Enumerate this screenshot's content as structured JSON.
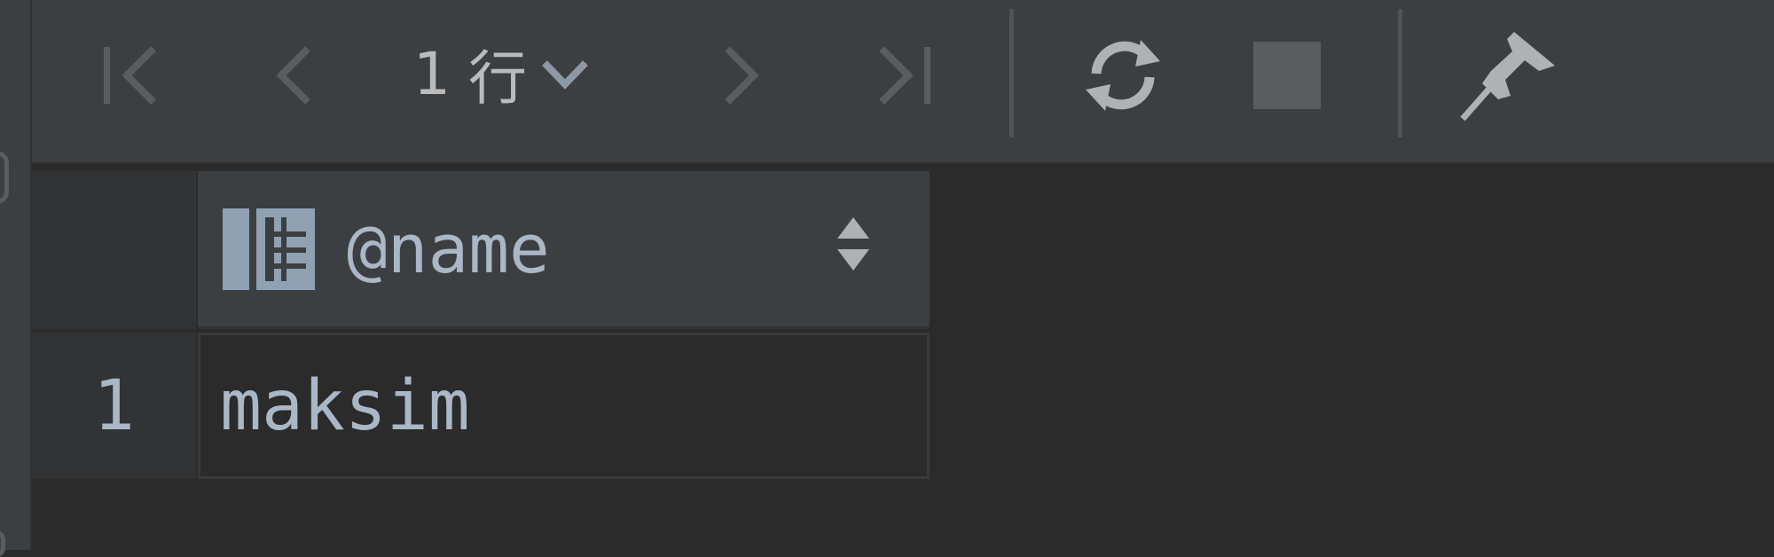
{
  "toolbar": {
    "first_icon": "first-page-icon",
    "prev_icon": "previous-page-icon",
    "row_count_number": "1",
    "row_count_unit": "行",
    "row_count_dropdown_icon": "chevron-down-icon",
    "next_icon": "next-page-icon",
    "last_icon": "last-page-icon",
    "refresh_icon": "refresh-icon",
    "stop_icon": "stop-icon",
    "pin_icon": "pin-icon"
  },
  "table": {
    "column_icon": "column-table-icon",
    "sort_icon": "sort-updown-icon",
    "columns": [
      "@name"
    ],
    "rows": [
      {
        "num": "1",
        "cells": [
          "maksim"
        ]
      }
    ]
  },
  "colors": {
    "toolbar_bg": "#3c3f41",
    "grid_bg": "#2b2b2b",
    "text": "#a9b7c6",
    "icon_disabled": "#5a5d5f",
    "icon_enabled": "#afb1b3"
  }
}
